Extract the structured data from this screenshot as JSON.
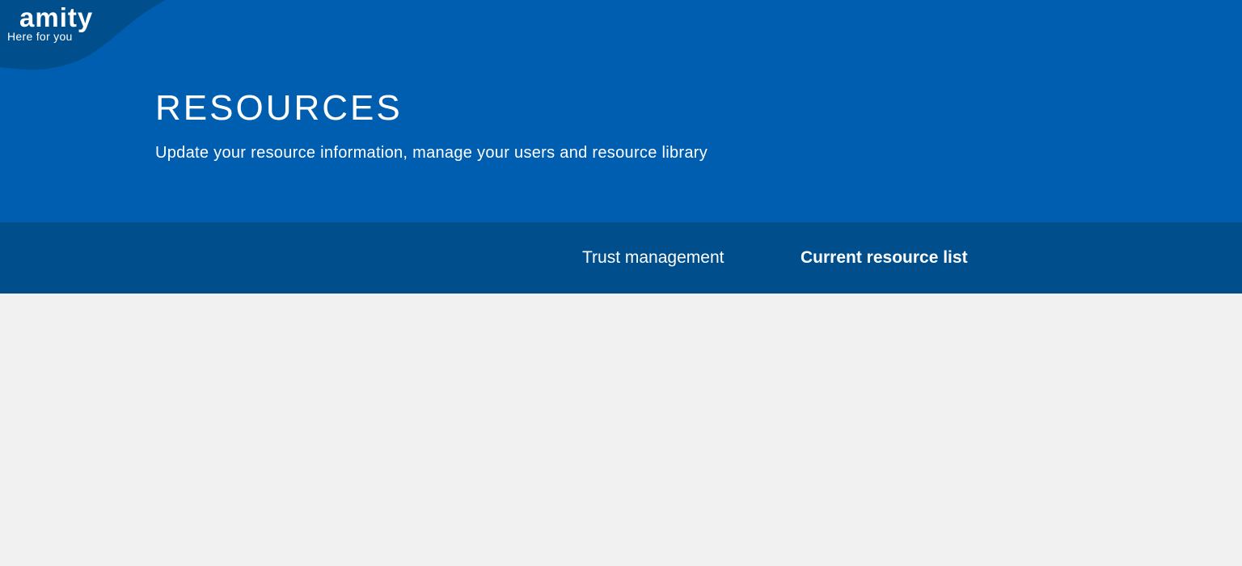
{
  "brand": {
    "name": "amity",
    "tagline": "Here for you"
  },
  "header": {
    "title": "RESOURCES",
    "subtitle": "Update your resource information, manage your users and resource library"
  },
  "tabs": [
    {
      "label": "Trust management",
      "active": false
    },
    {
      "label": "Current resource list",
      "active": true
    }
  ],
  "colors": {
    "hero_blue": "#005eb1",
    "tabbar_blue": "#004e8c",
    "logo_blob": "#004e8c",
    "background": "#f1f1f1",
    "text": "#ffffff"
  }
}
